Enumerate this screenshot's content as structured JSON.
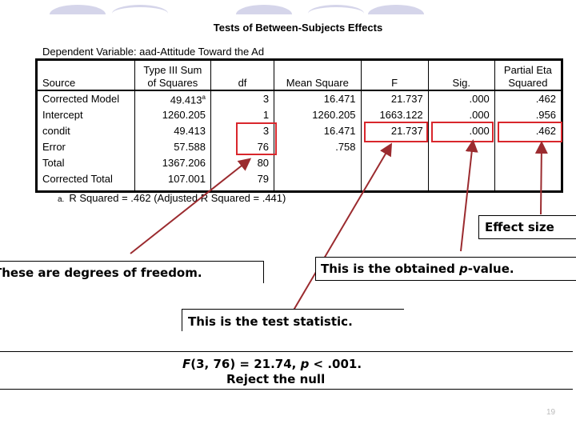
{
  "slide": {
    "title": "Tests of Between-Subjects Effects",
    "dependent_variable": "Dependent Variable: aad-Attitude Toward the Ad",
    "page_number": "19"
  },
  "table": {
    "headers": {
      "source": "Source",
      "ss_line1": "Type III Sum",
      "ss_line2": "of Squares",
      "df": "df",
      "ms": "Mean Square",
      "f": "F",
      "sig": "Sig.",
      "eta_line1": "Partial Eta",
      "eta_line2": "Squared"
    },
    "rows": [
      {
        "source": "Corrected Model",
        "ss": "49.413",
        "ss_note": "a",
        "df": "3",
        "ms": "16.471",
        "f": "21.737",
        "sig": ".000",
        "eta": ".462"
      },
      {
        "source": "Intercept",
        "ss": "1260.205",
        "ss_note": "",
        "df": "1",
        "ms": "1260.205",
        "f": "1663.122",
        "sig": ".000",
        "eta": ".956"
      },
      {
        "source": "condit",
        "ss": "49.413",
        "ss_note": "",
        "df": "3",
        "ms": "16.471",
        "f": "21.737",
        "sig": ".000",
        "eta": ".462"
      },
      {
        "source": "Error",
        "ss": "57.588",
        "ss_note": "",
        "df": "76",
        "ms": ".758",
        "f": "",
        "sig": "",
        "eta": ""
      },
      {
        "source": "Total",
        "ss": "1367.206",
        "ss_note": "",
        "df": "80",
        "ms": "",
        "f": "",
        "sig": "",
        "eta": ""
      },
      {
        "source": "Corrected Total",
        "ss": "107.001",
        "ss_note": "",
        "df": "79",
        "ms": "",
        "f": "",
        "sig": "",
        "eta": ""
      }
    ],
    "footnote_label": "a.",
    "footnote_text": "R Squared = .462 (Adjusted R Squared = .441)"
  },
  "callouts": {
    "degrees_of_freedom": "These are degrees of freedom.",
    "p_value_prefix": "This is the obtained ",
    "p_value_italic": "p",
    "p_value_suffix": "-value.",
    "effect_size": "Effect size",
    "test_statistic": "This is the test statistic."
  },
  "conclusion": {
    "f_symbol": "F",
    "f_args": "(3, 76) = 21.74, ",
    "p_symbol": "p",
    "p_rest": " < .001.",
    "line2": "Reject the null"
  },
  "colors": {
    "highlight": "#d9262c",
    "arrow": "#9b2b2f",
    "decor": "#d5d5ea"
  }
}
